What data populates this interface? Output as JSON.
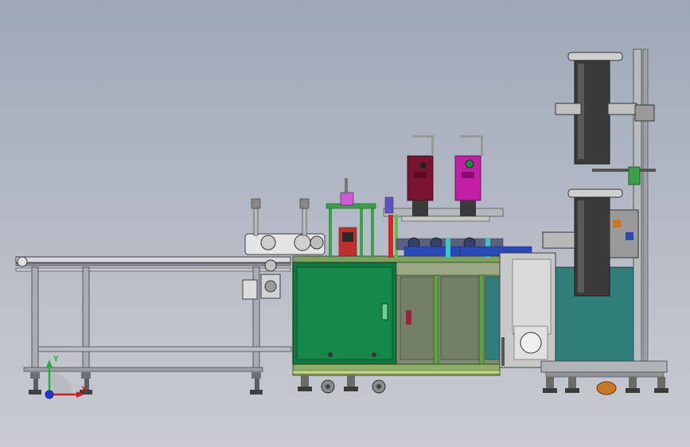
{
  "viewport": {
    "background_top": "#9fa8b8",
    "background_bottom": "#c9cbd1"
  },
  "colors": {
    "frame_gray": "#9aa0a6",
    "frame_dark": "#5d6166",
    "cabinet_green": "#0f7a3e",
    "cabinet_trim": "#6fae55",
    "panel_olive": "#7e8a72",
    "panel_teal": "#2f7e7a",
    "housing_gray": "#c8c8c8",
    "press_maroon": "#7a1430",
    "press_magenta": "#c21ea6",
    "roll_dark": "#3a3a3a",
    "pillar_green": "#3aa04a",
    "accent_red": "#d02828",
    "accent_blue": "#2a48b8",
    "accent_orange": "#c87828"
  },
  "triad": {
    "x_axis_label": "X",
    "y_axis_label": "Y",
    "z_axis_color": "#1e3cd2",
    "x_axis_color": "#d21e1e",
    "y_axis_color": "#1eb43c"
  }
}
